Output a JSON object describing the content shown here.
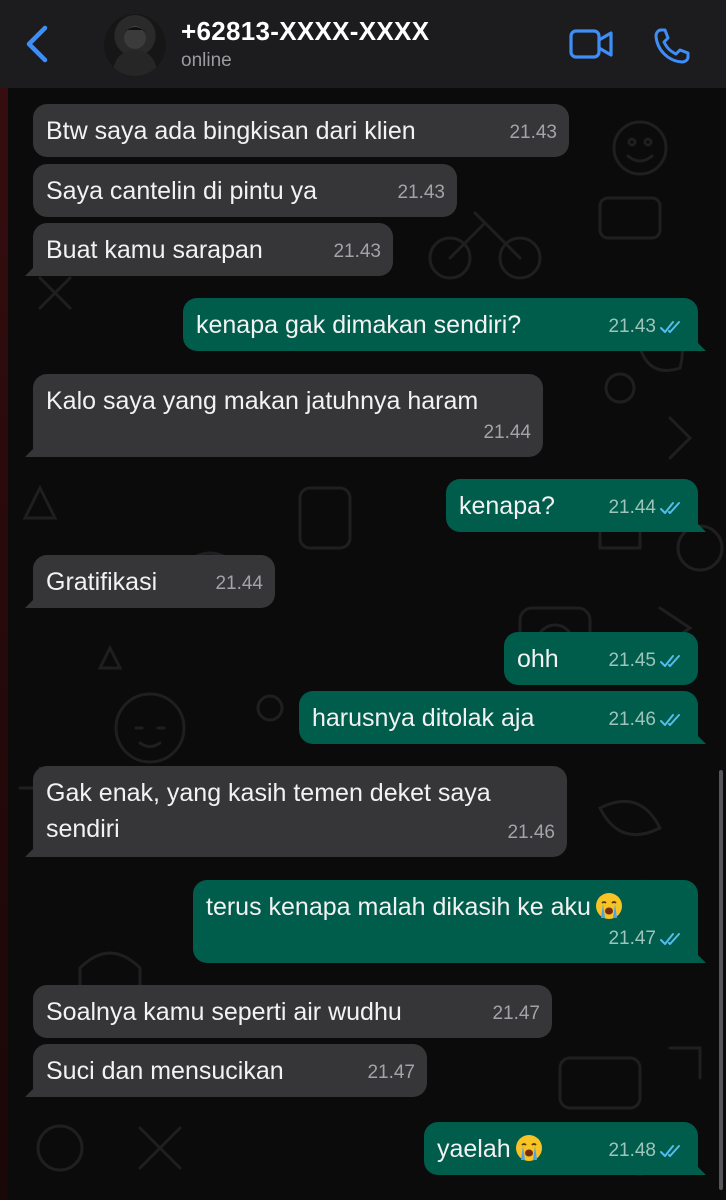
{
  "header": {
    "contact_name": "+62813-XXXX-XXXX",
    "status": "online",
    "back_icon": "chevron-left-icon",
    "video_icon": "video-camera-icon",
    "call_icon": "phone-icon",
    "accent_color": "#3e8ef7"
  },
  "messages": [
    {
      "dir": "in",
      "text": "Btw saya ada bingkisan dari klien",
      "time": "21.43"
    },
    {
      "dir": "in",
      "text": "Saya cantelin di pintu ya",
      "time": "21.43"
    },
    {
      "dir": "in",
      "text": "Buat kamu sarapan",
      "time": "21.43"
    },
    {
      "dir": "out",
      "text": "kenapa gak dimakan sendiri?",
      "time": "21.43",
      "read": true
    },
    {
      "dir": "in",
      "text": "Kalo saya yang makan jatuhnya haram",
      "time": "21.44"
    },
    {
      "dir": "out",
      "text": "kenapa?",
      "time": "21.44",
      "read": true
    },
    {
      "dir": "in",
      "text": "Gratifikasi",
      "time": "21.44"
    },
    {
      "dir": "out",
      "text": "ohh",
      "time": "21.45",
      "read": true
    },
    {
      "dir": "out",
      "text": "harusnya ditolak aja",
      "time": "21.46",
      "read": true
    },
    {
      "dir": "in",
      "text": "Gak enak, yang kasih temen deket saya sendiri",
      "time": "21.46"
    },
    {
      "dir": "out",
      "text": "terus kenapa malah dikasih ke aku",
      "emoji": "crying-face",
      "time": "21.47",
      "read": true
    },
    {
      "dir": "in",
      "text": "Soalnya kamu seperti air wudhu",
      "time": "21.47"
    },
    {
      "dir": "in",
      "text": "Suci dan mensucikan",
      "time": "21.47"
    },
    {
      "dir": "out",
      "text": "yaelah",
      "emoji": "crying-face",
      "time": "21.48",
      "read": true
    }
  ],
  "colors": {
    "incoming_bubble": "#363638",
    "outgoing_bubble": "#005c4b",
    "read_ticks": "#53bdeb",
    "header_bg": "#1c1c1e"
  }
}
